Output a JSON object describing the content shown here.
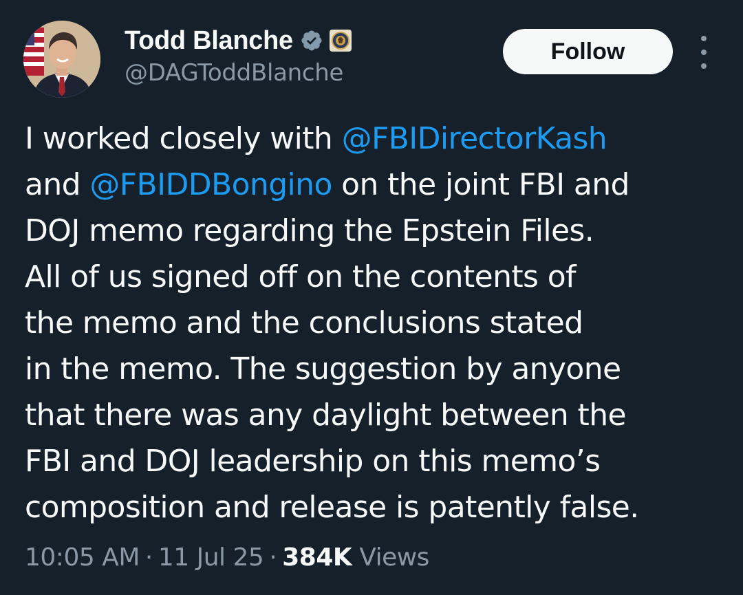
{
  "author": {
    "display_name": "Todd Blanche",
    "handle": "@DAGToddBlanche",
    "verified_badge_icon": "verified-badge-icon",
    "affiliation_badge_icon": "doj-seal-icon"
  },
  "actions": {
    "follow_label": "Follow",
    "more_icon": "more-vertical-icon"
  },
  "tweet": {
    "lines": [
      [
        {
          "t": "I worked closely with "
        },
        {
          "t": "@FBIDirectorKash",
          "m": true
        }
      ],
      [
        {
          "t": "and "
        },
        {
          "t": "@FBIDDBongino",
          "m": true
        },
        {
          "t": " on the joint FBI and"
        }
      ],
      [
        {
          "t": "DOJ memo regarding the Epstein Files."
        }
      ],
      [
        {
          "t": "All of us signed off on the contents of"
        }
      ],
      [
        {
          "t": "the memo and the conclusions stated"
        }
      ],
      [
        {
          "t": "in the memo. The suggestion by anyone"
        }
      ],
      [
        {
          "t": "that there was any daylight between the"
        }
      ],
      [
        {
          "t": "FBI and DOJ leadership on this memo’s"
        }
      ],
      [
        {
          "t": "composition and release is patently false."
        }
      ]
    ]
  },
  "meta": {
    "time": "10:05 AM",
    "date": "11 Jul 25",
    "separator": "·",
    "views_count": "384K",
    "views_label": "Views"
  },
  "colors": {
    "background": "#15202b",
    "text": "#f7f9f9",
    "secondary": "#8b98a5",
    "mention": "#1d9bf0",
    "verified": "#829aab"
  }
}
